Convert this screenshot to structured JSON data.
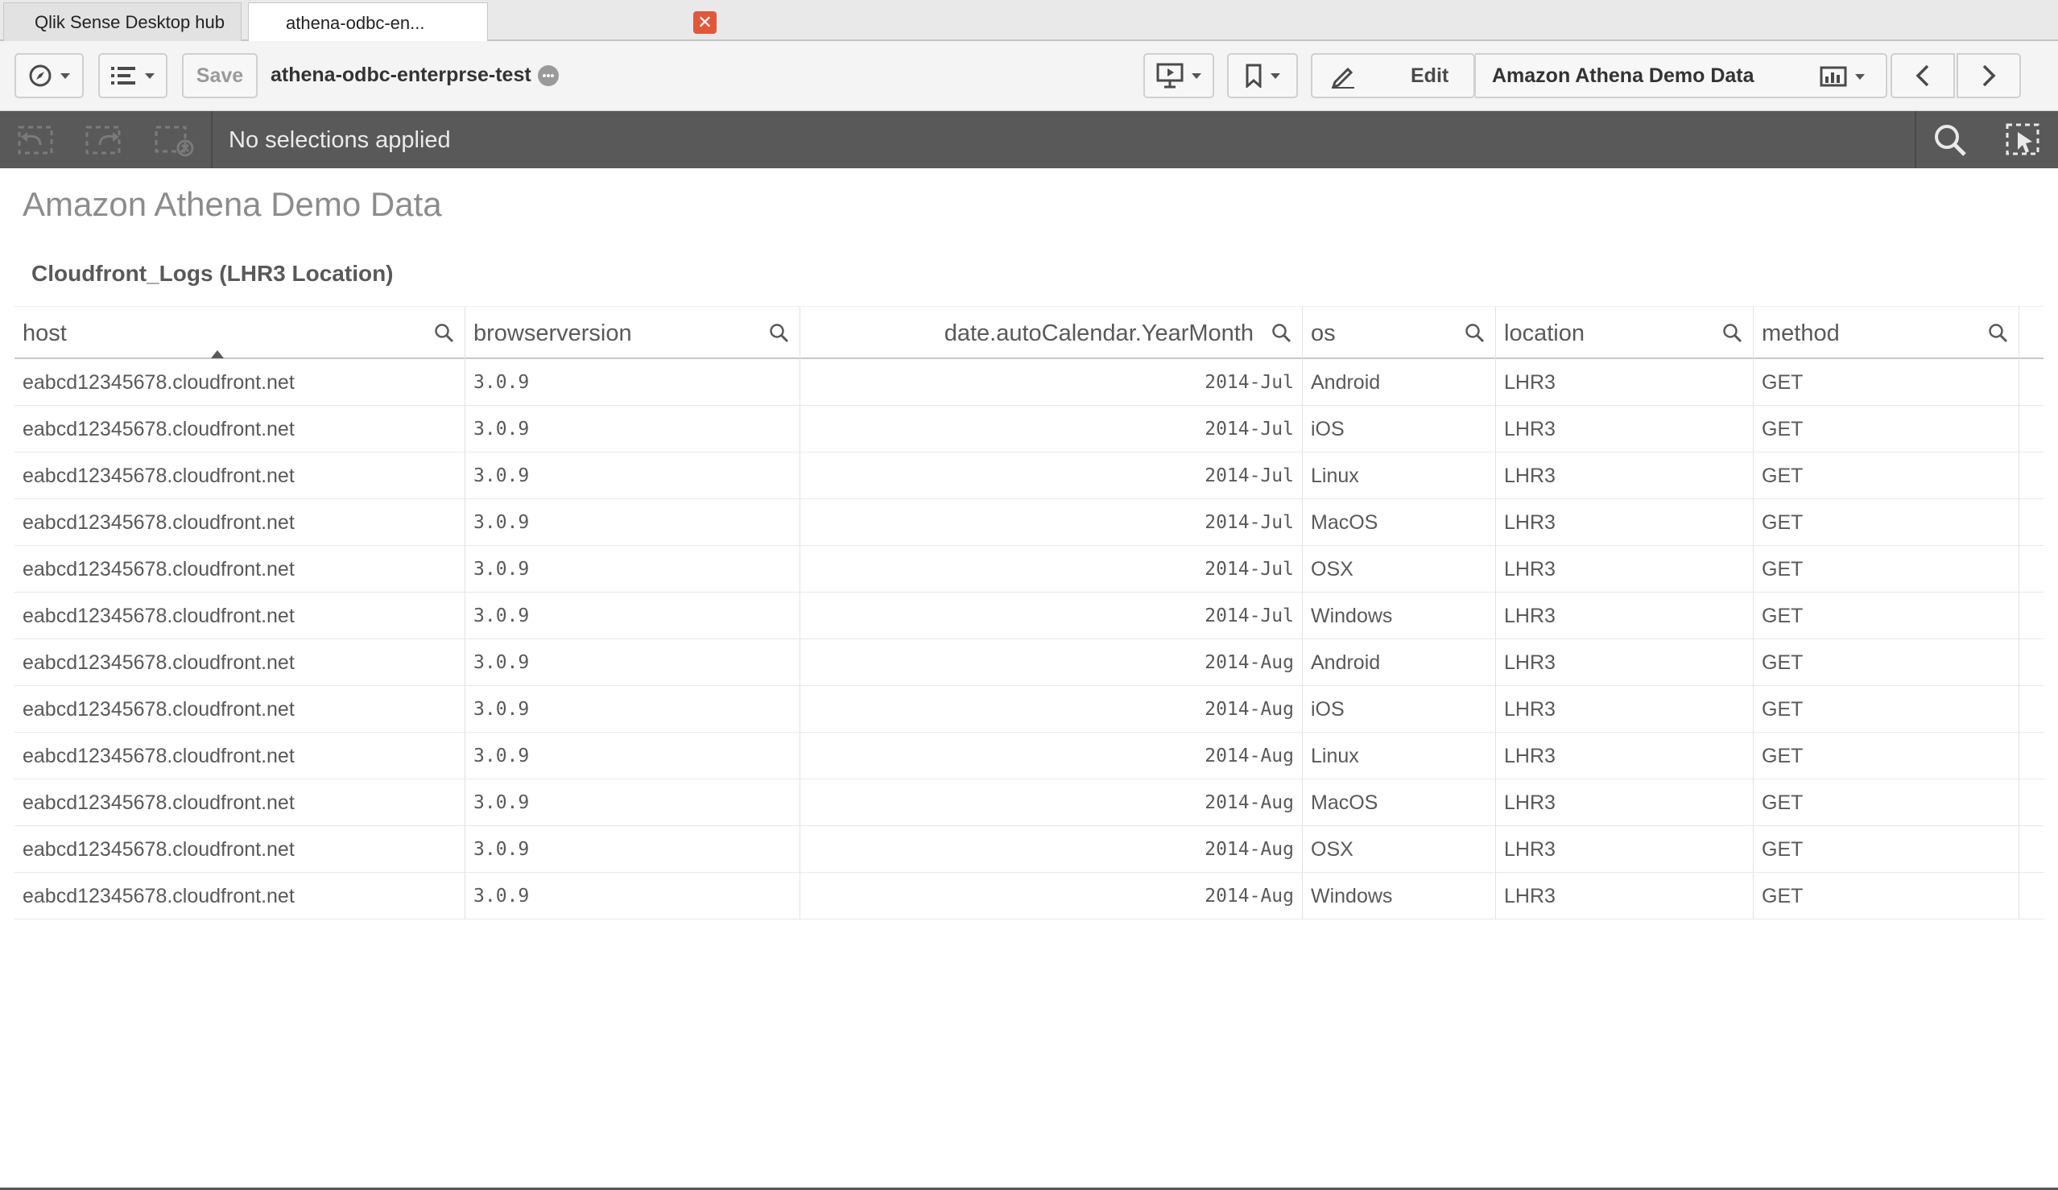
{
  "tabs": [
    {
      "label": "Qlik Sense Desktop hub"
    },
    {
      "label": "athena-odbc-en..."
    }
  ],
  "toolbar": {
    "save_label": "Save",
    "app_name": "athena-odbc-enterprse-test",
    "edit_label": "Edit",
    "sheet_name": "Amazon Athena Demo Data"
  },
  "selections": {
    "text": "No selections applied"
  },
  "sheet": {
    "title": "Amazon Athena Demo Data",
    "object_title": "Cloudfront_Logs (LHR3 Location)"
  },
  "table": {
    "headers": [
      "host",
      "browserversion",
      "date.autoCalendar.YearMonth",
      "os",
      "location",
      "method"
    ],
    "rows": [
      [
        "eabcd12345678.cloudfront.net",
        "3.0.9",
        "2014-Jul",
        "Android",
        "LHR3",
        "GET"
      ],
      [
        "eabcd12345678.cloudfront.net",
        "3.0.9",
        "2014-Jul",
        "iOS",
        "LHR3",
        "GET"
      ],
      [
        "eabcd12345678.cloudfront.net",
        "3.0.9",
        "2014-Jul",
        "Linux",
        "LHR3",
        "GET"
      ],
      [
        "eabcd12345678.cloudfront.net",
        "3.0.9",
        "2014-Jul",
        "MacOS",
        "LHR3",
        "GET"
      ],
      [
        "eabcd12345678.cloudfront.net",
        "3.0.9",
        "2014-Jul",
        "OSX",
        "LHR3",
        "GET"
      ],
      [
        "eabcd12345678.cloudfront.net",
        "3.0.9",
        "2014-Jul",
        "Windows",
        "LHR3",
        "GET"
      ],
      [
        "eabcd12345678.cloudfront.net",
        "3.0.9",
        "2014-Aug",
        "Android",
        "LHR3",
        "GET"
      ],
      [
        "eabcd12345678.cloudfront.net",
        "3.0.9",
        "2014-Aug",
        "iOS",
        "LHR3",
        "GET"
      ],
      [
        "eabcd12345678.cloudfront.net",
        "3.0.9",
        "2014-Aug",
        "Linux",
        "LHR3",
        "GET"
      ],
      [
        "eabcd12345678.cloudfront.net",
        "3.0.9",
        "2014-Aug",
        "MacOS",
        "LHR3",
        "GET"
      ],
      [
        "eabcd12345678.cloudfront.net",
        "3.0.9",
        "2014-Aug",
        "OSX",
        "LHR3",
        "GET"
      ],
      [
        "eabcd12345678.cloudfront.net",
        "3.0.9",
        "2014-Aug",
        "Windows",
        "LHR3",
        "GET"
      ]
    ]
  },
  "colors": {
    "selection_bar": "#595959",
    "tab_close": "#e0583c"
  },
  "icons": [
    "compass-icon",
    "list-icon",
    "info-icon",
    "present-icon",
    "bookmark-icon",
    "pencil-icon",
    "sheet-icon",
    "chevron-left-icon",
    "chevron-right-icon",
    "step-back-icon",
    "step-forward-icon",
    "clear-selections-icon",
    "search-icon",
    "lasso-select-icon"
  ]
}
